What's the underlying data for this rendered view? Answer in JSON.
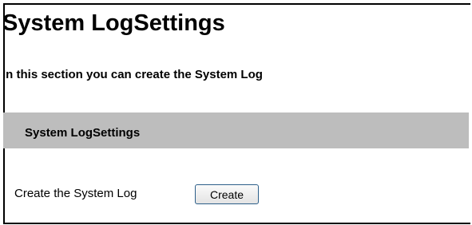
{
  "page": {
    "title": "System LogSettings",
    "intro": "In this section you can create the System Log"
  },
  "section": {
    "title": "System LogSettings",
    "create_label": "Create the System Log",
    "create_button": "Create"
  },
  "colors": {
    "section_bar": "#bdbdbd",
    "text": "#000000",
    "button_border": "#2d5f8a"
  }
}
